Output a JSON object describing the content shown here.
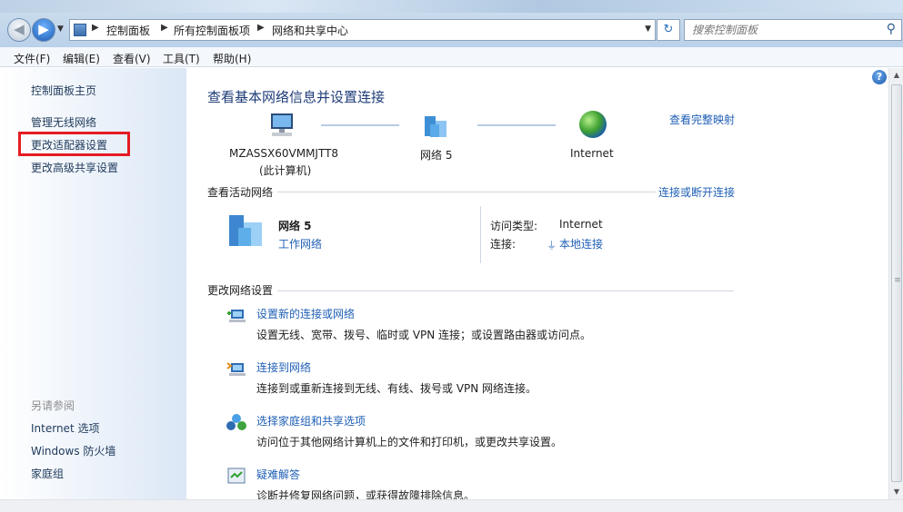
{
  "address_bar": {
    "breadcrumbs": [
      "控制面板",
      "所有控制面板项",
      "网络和共享中心"
    ],
    "search_placeholder": "搜索控制面板"
  },
  "menu": [
    "文件(F)",
    "编辑(E)",
    "查看(V)",
    "工具(T)",
    "帮助(H)"
  ],
  "sidebar": {
    "home": "控制面板主页",
    "links": [
      "管理无线网络",
      "更改适配器设置",
      "更改高级共享设置"
    ],
    "see_also_heading": "另请参阅",
    "see_also": [
      "Internet 选项",
      "Windows 防火墙",
      "家庭组"
    ]
  },
  "main": {
    "title": "查看基本网络信息并设置连接",
    "view_full_map": "查看完整映射",
    "nodes": {
      "computer_name": "MZASSX60VMMJTT8",
      "computer_sub": "(此计算机)",
      "network": "网络  5",
      "internet": "Internet"
    },
    "active": {
      "heading": "查看活动网络",
      "connect_link": "连接或断开连接",
      "network_name": "网络  5",
      "network_type": "工作网络",
      "access_type_label": "访问类型:",
      "access_type_value": "Internet",
      "connection_label": "连接:",
      "connection_value": "本地连接"
    },
    "change_settings": {
      "heading": "更改网络设置",
      "tasks": [
        {
          "link": "设置新的连接或网络",
          "desc": "设置无线、宽带、拨号、临时或 VPN 连接；或设置路由器或访问点。"
        },
        {
          "link": "连接到网络",
          "desc": "连接到或重新连接到无线、有线、拨号或 VPN 网络连接。"
        },
        {
          "link": "选择家庭组和共享选项",
          "desc": "访问位于其他网络计算机上的文件和打印机，或更改共享设置。"
        },
        {
          "link": "疑难解答",
          "desc": "诊断并修复网络问题，或获得故障排除信息。"
        }
      ]
    }
  },
  "help_label": "?",
  "icons": [
    "back-icon",
    "forward-icon",
    "refresh-icon",
    "search-icon",
    "help-icon",
    "computer-icon",
    "network-icon",
    "globe-icon",
    "plug-icon"
  ]
}
